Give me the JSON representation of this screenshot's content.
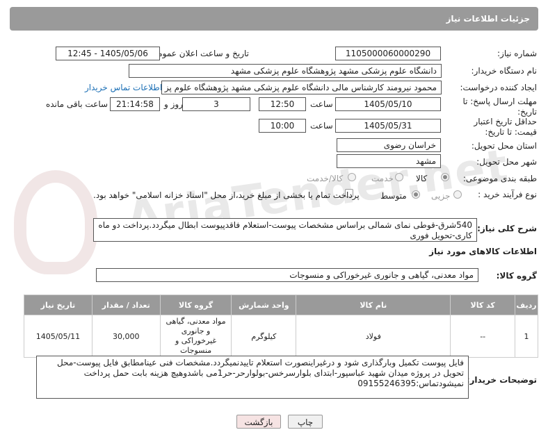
{
  "header": {
    "title": "جزئیات اطلاعات نیاز"
  },
  "form": {
    "need_number_label": "شماره نیاز:",
    "need_number": "1105000060000290",
    "announce_label": "تاریخ و ساعت اعلان عمومی:",
    "announce_value": "1405/05/06 - 12:45",
    "buyer_org_label": "نام دستگاه خریدار:",
    "buyer_org": "دانشگاه علوم پزشکی مشهد   پژوهشگاه علوم پزشکی مشهد",
    "requester_label": "ایجاد کننده درخواست:",
    "requester": "محمود نیرومند کارشناس مالی دانشگاه علوم پزشکی مشهد   پژوهشگاه علوم پز",
    "contact_link": "اطلاعات تماس خریدار",
    "deadline_label": "مهلت ارسال پاسخ: تا تاریخ:",
    "deadline_date": "1405/05/10",
    "time_label": "ساعت",
    "deadline_time": "12:50",
    "days_value": "3",
    "days_label": "روز و",
    "remaining_time": "21:14:58",
    "remaining_label": "ساعت باقی مانده",
    "validity_label": "حداقل تاریخ اعتبار قیمت: تا تاریخ:",
    "validity_date": "1405/05/31",
    "validity_time": "10:00",
    "province_label": "استان محل تحویل:",
    "province": "خراسان رضوی",
    "city_label": "شهر محل تحویل:",
    "city": "مشهد",
    "category_label": "طبقه بندی موضوعی:",
    "category_options": [
      "کالا",
      "خدمت",
      "کالا/خدمت"
    ],
    "process_label": "نوع فرآیند خرید :",
    "process_options": [
      "جزیی",
      "متوسط"
    ],
    "payment_note": "پرداخت تمام یا بخشی از مبلغ خرید،از محل \"اسناد خزانه اسلامی\" خواهد بود."
  },
  "description": {
    "label": "شرح کلی نیاز:",
    "text": "540شرق-قوطی نمای شمالی براساس مشخصات پیوست-استعلام فاقدپیوست ابطال میگردد.پرداخت دو ماه کاری-تحویل فوری"
  },
  "goods_section": {
    "title": "اطلاعات کالاهای مورد نیاز",
    "group_label": "گروه کالا:",
    "group_value": "مواد معدنی، گیاهی و جانوری غیرخوراکی و منسوجات"
  },
  "table": {
    "headers": [
      "ردیف",
      "کد کالا",
      "نام کالا",
      "واحد شمارش",
      "گروه کالا",
      "تعداد / مقدار",
      "تاریخ نیاز"
    ],
    "rows": [
      [
        "1",
        "--",
        "فولاد",
        "کیلوگرم",
        "مواد معدنی، گیاهی و جانوری غیرخوراکی و منسوجات",
        "30,000",
        "1405/05/11"
      ]
    ]
  },
  "buyer_notes": {
    "label": "توضیحات خریدار:",
    "text": "فایل پیوست تکمیل وبارگذاری شود و درغیراینصورت استعلام تاییدنمیگردد.مشخصات فنی عینامطابق فایل پیوست-محل تحویل در پروژه میدان شهید عباسپور-ابتدای بلوارسرخس-بولوارحر-حر1می باشدوهیچ هزینه بابت حمل  پرداخت نمیشودتماس:09155246395"
  },
  "buttons": {
    "print": "چاپ",
    "back": "بازگشت"
  },
  "watermark": "AriaTender.net"
}
